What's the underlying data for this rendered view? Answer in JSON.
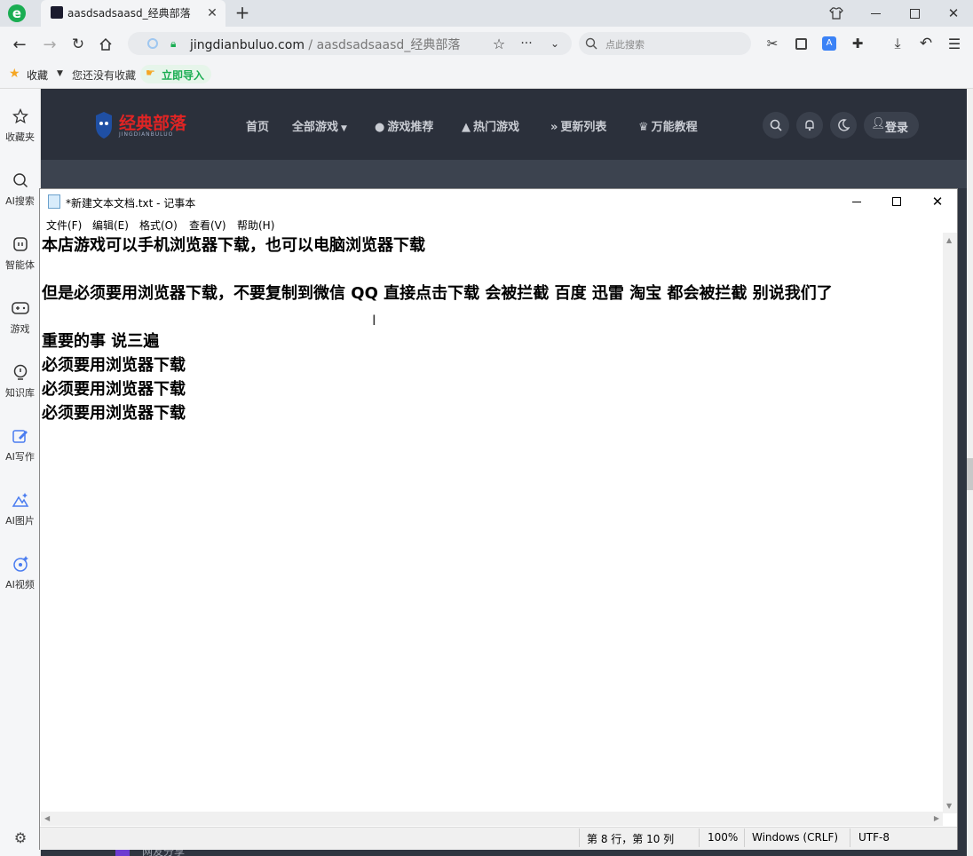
{
  "browser": {
    "tab_title": "aasdsadsaasd_经典部落",
    "url_domain": "jingdianbuluo.com",
    "url_path": " / aasdsadsaasd_经典部落",
    "search_placeholder": "点此搜索",
    "bookmarks": {
      "favorites": "收藏",
      "no_favorites": "您还没有收藏",
      "import": "立即导入"
    }
  },
  "sidebar": {
    "items": [
      {
        "label": "收藏夹",
        "icon": "star-icon"
      },
      {
        "label": "AI搜索",
        "icon": "search-icon"
      },
      {
        "label": "智能体",
        "icon": "agent-icon"
      },
      {
        "label": "游戏",
        "icon": "gamepad-icon"
      },
      {
        "label": "知识库",
        "icon": "bulb-icon"
      },
      {
        "label": "AI写作",
        "icon": "pen-icon"
      },
      {
        "label": "AI图片",
        "icon": "image-icon"
      },
      {
        "label": "AI视频",
        "icon": "video-icon"
      }
    ]
  },
  "site": {
    "logo_text": "经典部落",
    "logo_sub": "JINGDIANBULUO",
    "nav": [
      {
        "label": "首页"
      },
      {
        "label": "全部游戏"
      },
      {
        "label": "游戏推荐"
      },
      {
        "label": "热门游戏"
      },
      {
        "label": "更新列表"
      },
      {
        "label": "万能教程"
      }
    ],
    "login": "登录",
    "footer_peek": "网友分享"
  },
  "notepad": {
    "title": "*新建文本文档.txt - 记事本",
    "menu": [
      "文件(F)",
      "编辑(E)",
      "格式(O)",
      "查看(V)",
      "帮助(H)"
    ],
    "lines": [
      "本店游戏可以手机浏览器下载，也可以电脑浏览器下载",
      "",
      "但是必须要用浏览器下载，不要复制到微信 QQ 直接点击下载  会被拦截 百度 迅雷 淘宝 都会被拦截 别说我们了",
      "",
      "重要的事 说三遍",
      "必须要用浏览器下载",
      "必须要用浏览器下载",
      "必须要用浏览器下载"
    ],
    "status": {
      "position": "第 8 行，第 10 列",
      "zoom": "100%",
      "line_ending": "Windows (CRLF)",
      "encoding": "UTF-8"
    }
  },
  "colors": {
    "accent_green": "#1aad52",
    "site_bg": "#2b303b",
    "logo_red": "#e02424"
  }
}
